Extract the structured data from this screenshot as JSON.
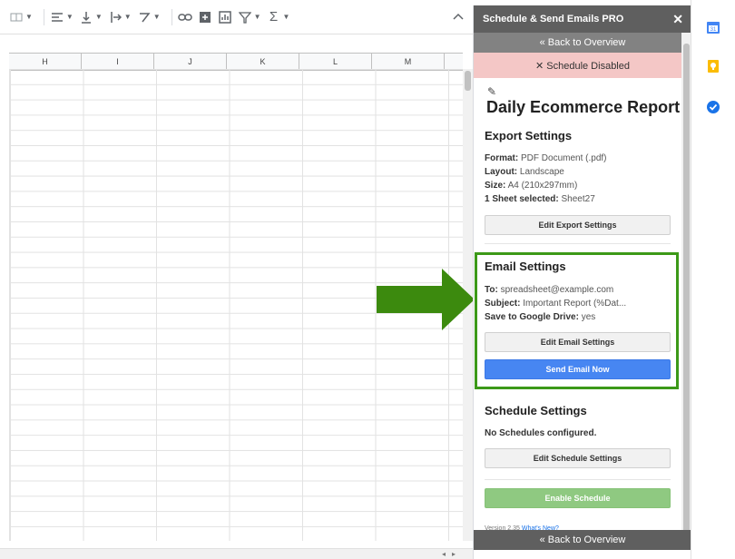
{
  "colors": {
    "panel_header_bg": "#5f5f5f",
    "back_bar_bg": "#828282",
    "status_bg": "#f4c7c6",
    "send_button": "#4786f2",
    "enable_button": "#8fc981",
    "highlight_green": "#3c9918"
  },
  "toolbar": {
    "icons": [
      "wrap-icon",
      "align-left-icon",
      "valign-icon",
      "text-direction-icon",
      "rotate-icon",
      "link-icon",
      "comment-icon",
      "chart-icon",
      "filter-icon",
      "sum-icon"
    ]
  },
  "sheet": {
    "columns": [
      "H",
      "I",
      "J",
      "K",
      "L",
      "M"
    ]
  },
  "panel": {
    "title": "Schedule & Send Emails PRO",
    "close": "✕",
    "back_top": "« Back to Overview",
    "status": "✕ Schedule Disabled",
    "report_title": "Daily Ecommerce Report",
    "export": {
      "heading": "Export Settings",
      "format_label": "Format:",
      "format_value": " PDF Document (.pdf)",
      "layout_label": "Layout:",
      "layout_value": " Landscape",
      "size_label": "Size:",
      "size_value": " A4 (210x297mm)",
      "sheet_label": "1 Sheet selected:",
      "sheet_value": " Sheet27",
      "edit_button": "Edit Export Settings"
    },
    "email": {
      "heading": "Email Settings",
      "to_label": "To:",
      "to_value": " spreadsheet@example.com",
      "subject_label": "Subject:",
      "subject_value": " Important Report (%Dat...",
      "drive_label": "Save to Google Drive:",
      "drive_value": " yes",
      "edit_button": "Edit Email Settings",
      "send_button": "Send Email Now"
    },
    "schedule": {
      "heading": "Schedule Settings",
      "none": "No Schedules configured.",
      "edit_button": "Edit Schedule Settings",
      "enable_button": "Enable Schedule"
    },
    "version": "Version 2.35",
    "version_link": "What's New?",
    "back_bottom": "« Back to Overview"
  }
}
